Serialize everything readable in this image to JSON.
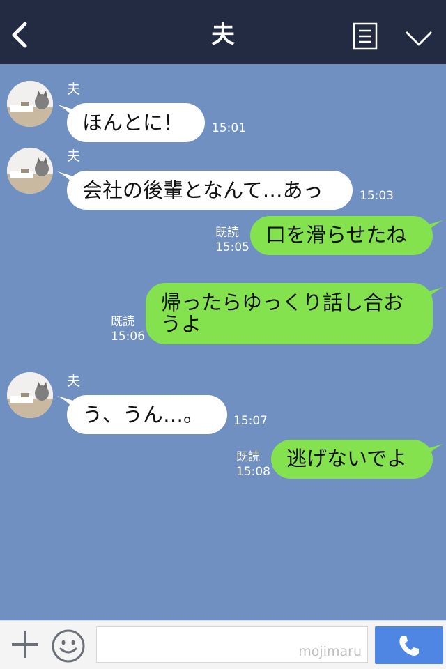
{
  "header": {
    "title": "夫",
    "back_icon": "chevron-left-icon",
    "menu_icon": "menu-icon",
    "dropdown_icon": "chevron-down-icon",
    "background": "#232b43"
  },
  "chat": {
    "background": "#7090c2",
    "messages": [
      {
        "direction": "incoming",
        "sender": "夫",
        "text": "ほんとに！",
        "time": "15:01"
      },
      {
        "direction": "incoming",
        "sender": "夫",
        "text": "会社の後輩となんて…あっ",
        "time": "15:03"
      },
      {
        "direction": "outgoing",
        "read": "既読",
        "text": "口を滑らせたね",
        "time": "15:05"
      },
      {
        "direction": "outgoing",
        "read": "既読",
        "text": "帰ったらゆっくり話し合おうよ",
        "lines": [
          "帰ったらゆっくり話し合お",
          "うよ"
        ],
        "time": "15:06"
      },
      {
        "direction": "incoming",
        "sender": "夫",
        "text": "う、うん…。",
        "time": "15:07"
      },
      {
        "direction": "outgoing",
        "read": "既読",
        "text": "逃げないでよ",
        "time": "15:08"
      }
    ],
    "incoming_bubble_color": "#ffffff",
    "outgoing_bubble_color": "#84e24f"
  },
  "input_bar": {
    "plus_icon": "plus-icon",
    "emoji_icon": "smiley-icon",
    "watermark": "mojimaru",
    "call_icon": "phone-icon",
    "call_button_color": "#4f86e3"
  }
}
